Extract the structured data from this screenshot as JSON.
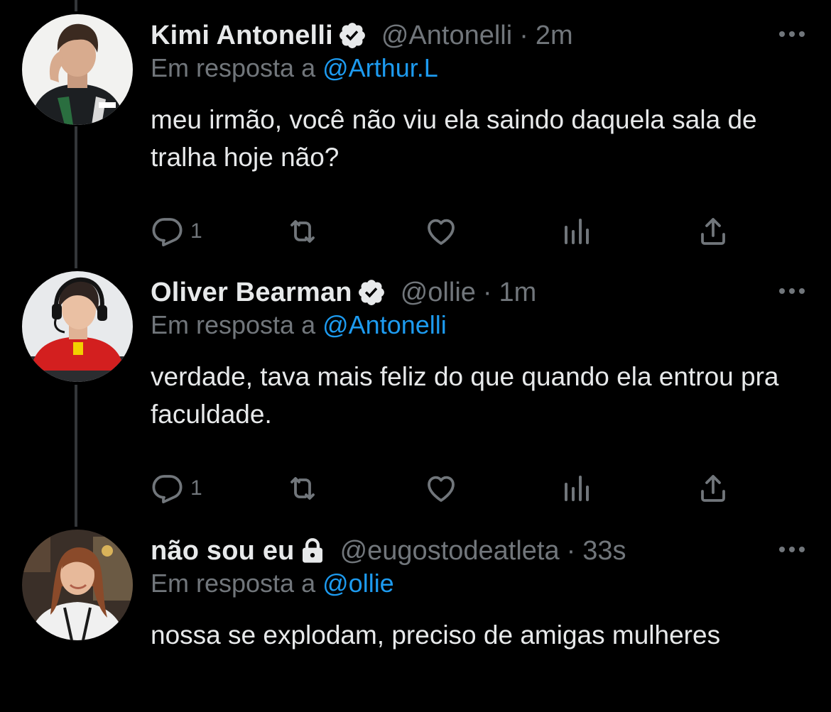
{
  "colors": {
    "background": "#000000",
    "text": "#e7e9ea",
    "secondary": "#71767b",
    "link": "#1d9bf0",
    "thread_line": "#333639"
  },
  "tweets": [
    {
      "name": "Kimi Antonelli",
      "badge": "verified-icon",
      "handle": "@Antonelli",
      "dot": "·",
      "time": "2m",
      "reply_prefix": "Em resposta a",
      "reply_to": "@Arthur.L",
      "text": "meu irmão, você não viu ela saindo daquela sala de tralha hoje não?",
      "reply_count": "1"
    },
    {
      "name": "Oliver Bearman",
      "badge": "verified-icon",
      "handle": "@ollie",
      "dot": "·",
      "time": "1m",
      "reply_prefix": "Em resposta a",
      "reply_to": "@Antonelli",
      "text": "verdade, tava mais feliz do que quando ela entrou pra faculdade.",
      "reply_count": "1"
    },
    {
      "name": "não sou eu",
      "badge": "lock-icon",
      "handle": "@eugostodeatleta",
      "dot": "·",
      "time": "33s",
      "reply_prefix": "Em resposta a",
      "reply_to": "@ollie",
      "text": "nossa se explodam, preciso de amigas mulheres"
    }
  ]
}
